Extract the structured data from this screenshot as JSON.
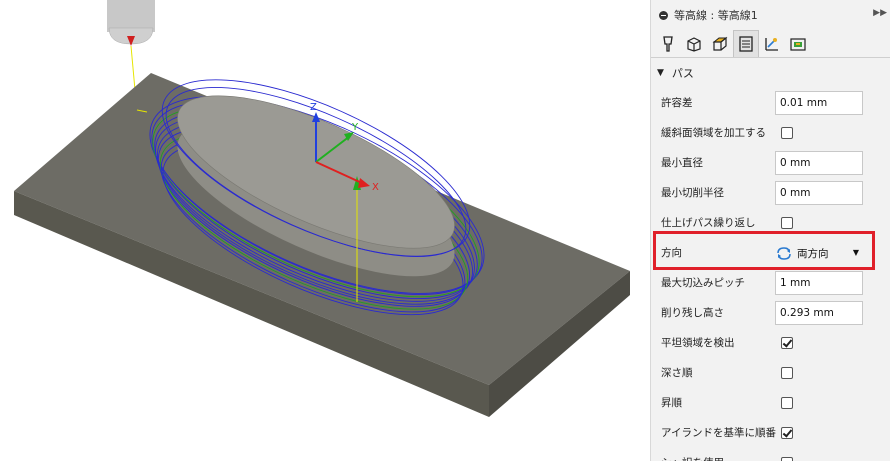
{
  "panel": {
    "title": "等高線 : 等高線1",
    "section": "パス",
    "tabs": [
      "tool-tab-icon",
      "geometry-tab-icon",
      "heights-tab-icon",
      "passes-tab-icon",
      "linking-tab-icon",
      "stock-tab-icon"
    ],
    "rows": [
      {
        "label": "許容差",
        "type": "input",
        "value": "0.01 mm"
      },
      {
        "label": "緩斜面領域を加工する",
        "type": "checkbox",
        "checked": false
      },
      {
        "label": "最小直径",
        "type": "input",
        "value": "0 mm"
      },
      {
        "label": "最小切削半径",
        "type": "input",
        "value": "0 mm"
      },
      {
        "label": "仕上げパス繰り返し",
        "type": "checkbox",
        "checked": false
      },
      {
        "label": "方向",
        "type": "select",
        "value": "両方向"
      },
      {
        "label": "最大切込みピッチ",
        "type": "input",
        "value": "1 mm"
      },
      {
        "label": "削り残し高さ",
        "type": "input",
        "value": "0.293 mm"
      },
      {
        "label": "平坦領域を検出",
        "type": "checkbox",
        "checked": true
      },
      {
        "label": "深さ順",
        "type": "checkbox",
        "checked": false
      },
      {
        "label": "昇順",
        "type": "checkbox",
        "checked": false
      },
      {
        "label": "アイランドを基準に順番",
        "type": "checkbox",
        "checked": true
      },
      {
        "label": "シャ訳を使用",
        "type": "checkbox",
        "checked": false
      }
    ]
  },
  "viewport": {
    "axes": {
      "z": "Z",
      "y": "Y",
      "x": "X"
    },
    "colors": {
      "toolpath": "#2a2ad0",
      "link": "#20a020",
      "stock": "#6b6a62",
      "axis_x": "#e02020",
      "axis_y": "#20b020",
      "axis_z": "#2040e0",
      "highlight": "#e0202a"
    }
  }
}
